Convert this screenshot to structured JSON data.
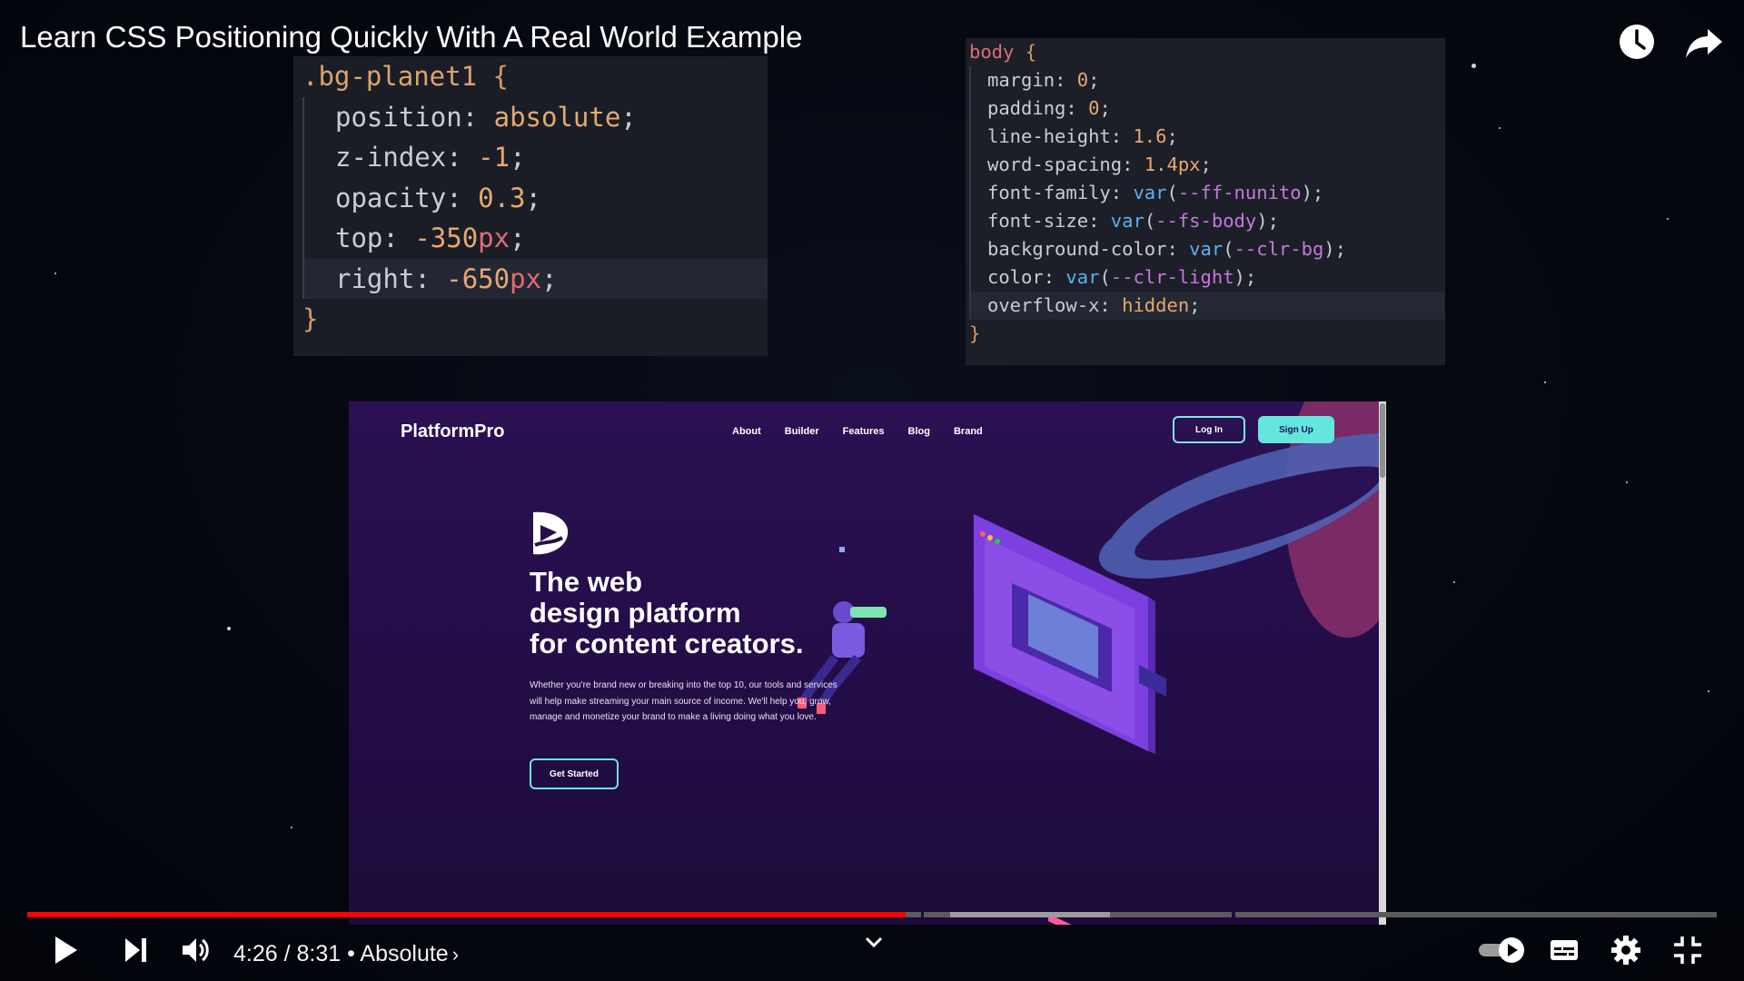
{
  "video": {
    "title": "Learn CSS Positioning Quickly With A Real World Example",
    "time_display": "4:26 / 8:31",
    "chapter_sep": " • ",
    "chapter": "Absolute",
    "progress_fraction": 0.52
  },
  "code_left": {
    "selector": ".bg-planet1",
    "lines": [
      {
        "prop": "position",
        "val": "absolute"
      },
      {
        "prop": "z-index",
        "val": "-1"
      },
      {
        "prop": "opacity",
        "val": "0.3"
      },
      {
        "prop": "top",
        "val": "-350",
        "unit": "px"
      },
      {
        "prop": "right",
        "val": "-650",
        "unit": "px"
      }
    ]
  },
  "code_right": {
    "selector": "body",
    "lines": [
      {
        "prop": "margin",
        "val": "0"
      },
      {
        "prop": "padding",
        "val": "0"
      },
      {
        "prop": "line-height",
        "val": "1.6"
      },
      {
        "prop": "word-spacing",
        "val": "1.4px"
      },
      {
        "prop": "font-family",
        "fn": "var",
        "arg": "--ff-nunito"
      },
      {
        "prop": "font-size",
        "fn": "var",
        "arg": "--fs-body"
      },
      {
        "prop": "background-color",
        "fn": "var",
        "arg": "--clr-bg"
      },
      {
        "prop": "color",
        "fn": "var",
        "arg": "--clr-light"
      },
      {
        "prop": "overflow-x",
        "val": "hidden"
      }
    ]
  },
  "site": {
    "logo": "PlatformPro",
    "nav": [
      "About",
      "Builder",
      "Features",
      "Blog",
      "Brand"
    ],
    "login": "Log In",
    "signup": "Sign Up",
    "headline": [
      "The web",
      "design platform",
      "for content creators."
    ],
    "paragraph": "Whether you're brand new or breaking into the top 10, our tools and services will help make streaming your main source of income. We'll help you, grow, manage and monetize your brand to make a living doing what you love.",
    "cta": "Get Started"
  },
  "icons": [
    "watch-later-icon",
    "share-icon",
    "play-icon",
    "next-icon",
    "volume-icon",
    "chevron-down-icon",
    "autoplay-toggle-icon",
    "subtitles-icon",
    "settings-icon",
    "exit-fullscreen-icon"
  ],
  "colors": {
    "progress_played": "#ff0000",
    "site_bg": "#250e4a",
    "accent_teal": "#64e6df"
  }
}
